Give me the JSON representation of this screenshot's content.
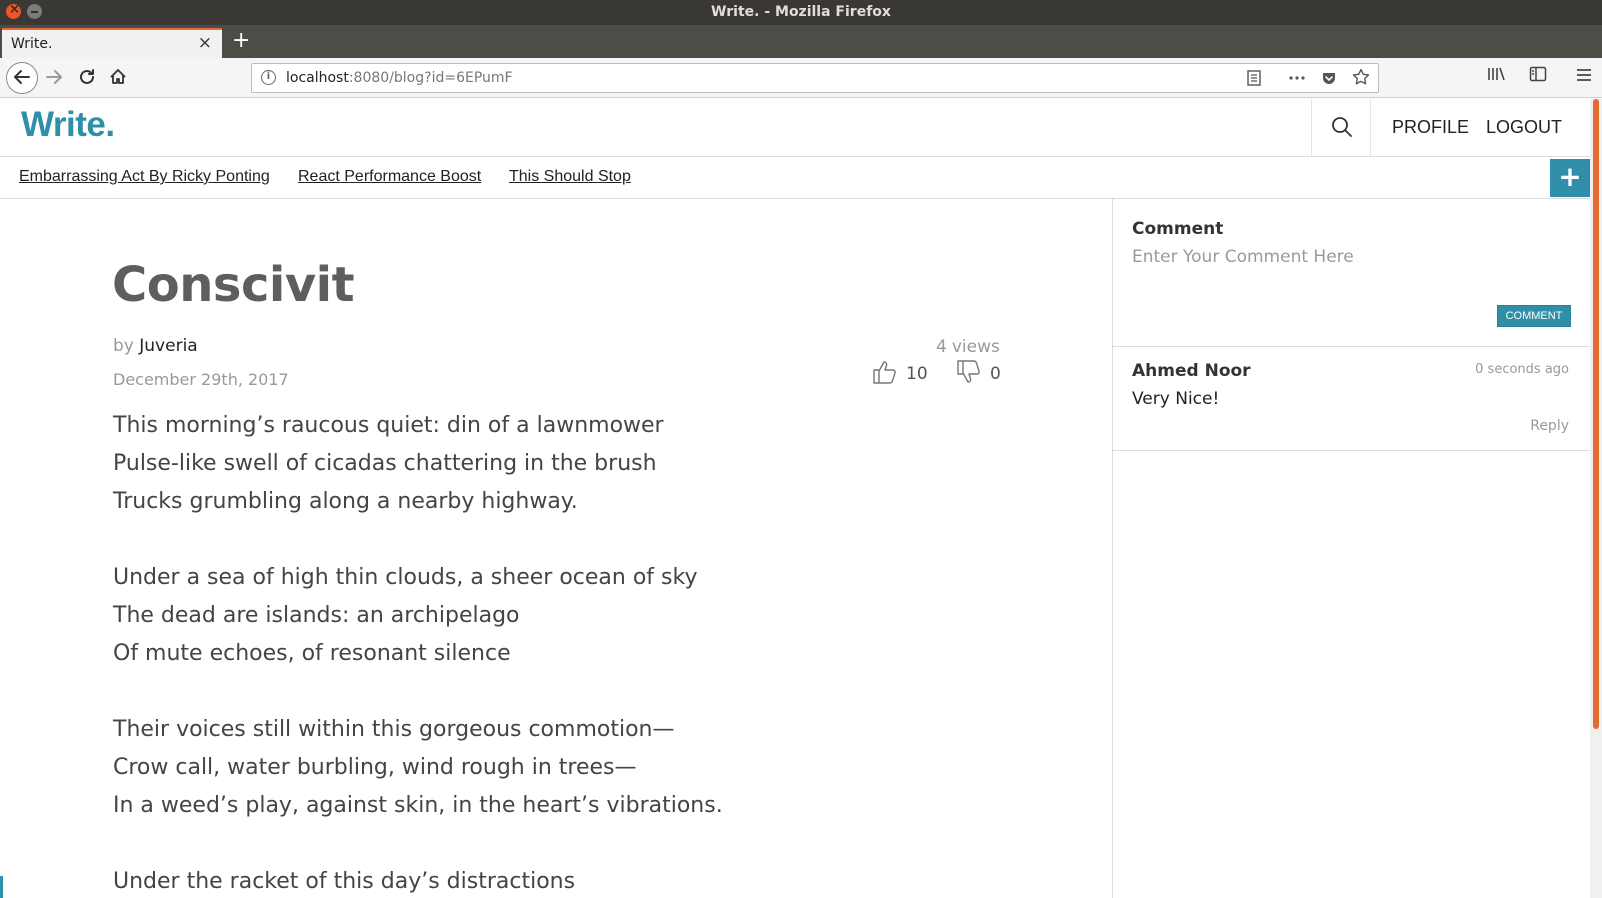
{
  "window": {
    "title": "Write. - Mozilla Firefox"
  },
  "tab": {
    "title": "Write.",
    "close_glyph": "×",
    "new_tab_glyph": "+"
  },
  "urlbar": {
    "host": "localhost",
    "path": ":8080/blog?id=6EPumF"
  },
  "site": {
    "logo": "Write.",
    "nav": {
      "profile": "PROFILE",
      "logout": "LOGOUT"
    },
    "blog_links": [
      "Embarrassing Act By Ricky Ponting",
      "React Performance Boost",
      "This Should Stop"
    ],
    "add_glyph": "+",
    "accent_color": "#2f8fa8"
  },
  "post": {
    "title": "Conscivit",
    "by_prefix": "by",
    "author": "Juveria",
    "date": "December 29th, 2017",
    "views_count": "4",
    "views_label": "views",
    "likes": "10",
    "dislikes": "0",
    "lines": [
      "This morning’s raucous quiet: din of a lawnmower",
      "Pulse-like swell of cicadas chattering in the brush",
      "Trucks grumbling along a nearby highway.",
      "",
      "Under a sea of high thin clouds, a sheer ocean of sky",
      "The dead are islands: an archipelago",
      "Of mute echoes, of resonant silence",
      "",
      "Their voices still within this gorgeous commotion—",
      "Crow call, water burbling, wind rough in trees—",
      "In a weed’s play, against skin, in the heart’s vibrations.",
      "",
      "Under the racket of this day’s distractions"
    ]
  },
  "comment_form": {
    "label": "Comment",
    "placeholder": "Enter Your Comment Here",
    "submit": "COMMENT"
  },
  "comments": [
    {
      "author": "Ahmed Noor",
      "time": "0 seconds ago",
      "text": "Very Nice!",
      "reply": "Reply"
    }
  ],
  "icons": {
    "back": "back-arrow-icon",
    "forward": "forward-arrow-icon",
    "reload": "reload-icon",
    "home": "home-icon",
    "info": "info-icon",
    "reader": "reader-view-icon",
    "more": "more-actions-icon",
    "pocket": "pocket-icon",
    "bookmark": "bookmark-star-icon",
    "library": "library-icon",
    "sidebar": "sidebar-icon",
    "menu": "hamburger-menu-icon",
    "search": "search-icon",
    "like": "thumbs-up-icon",
    "dislike": "thumbs-down-icon"
  }
}
